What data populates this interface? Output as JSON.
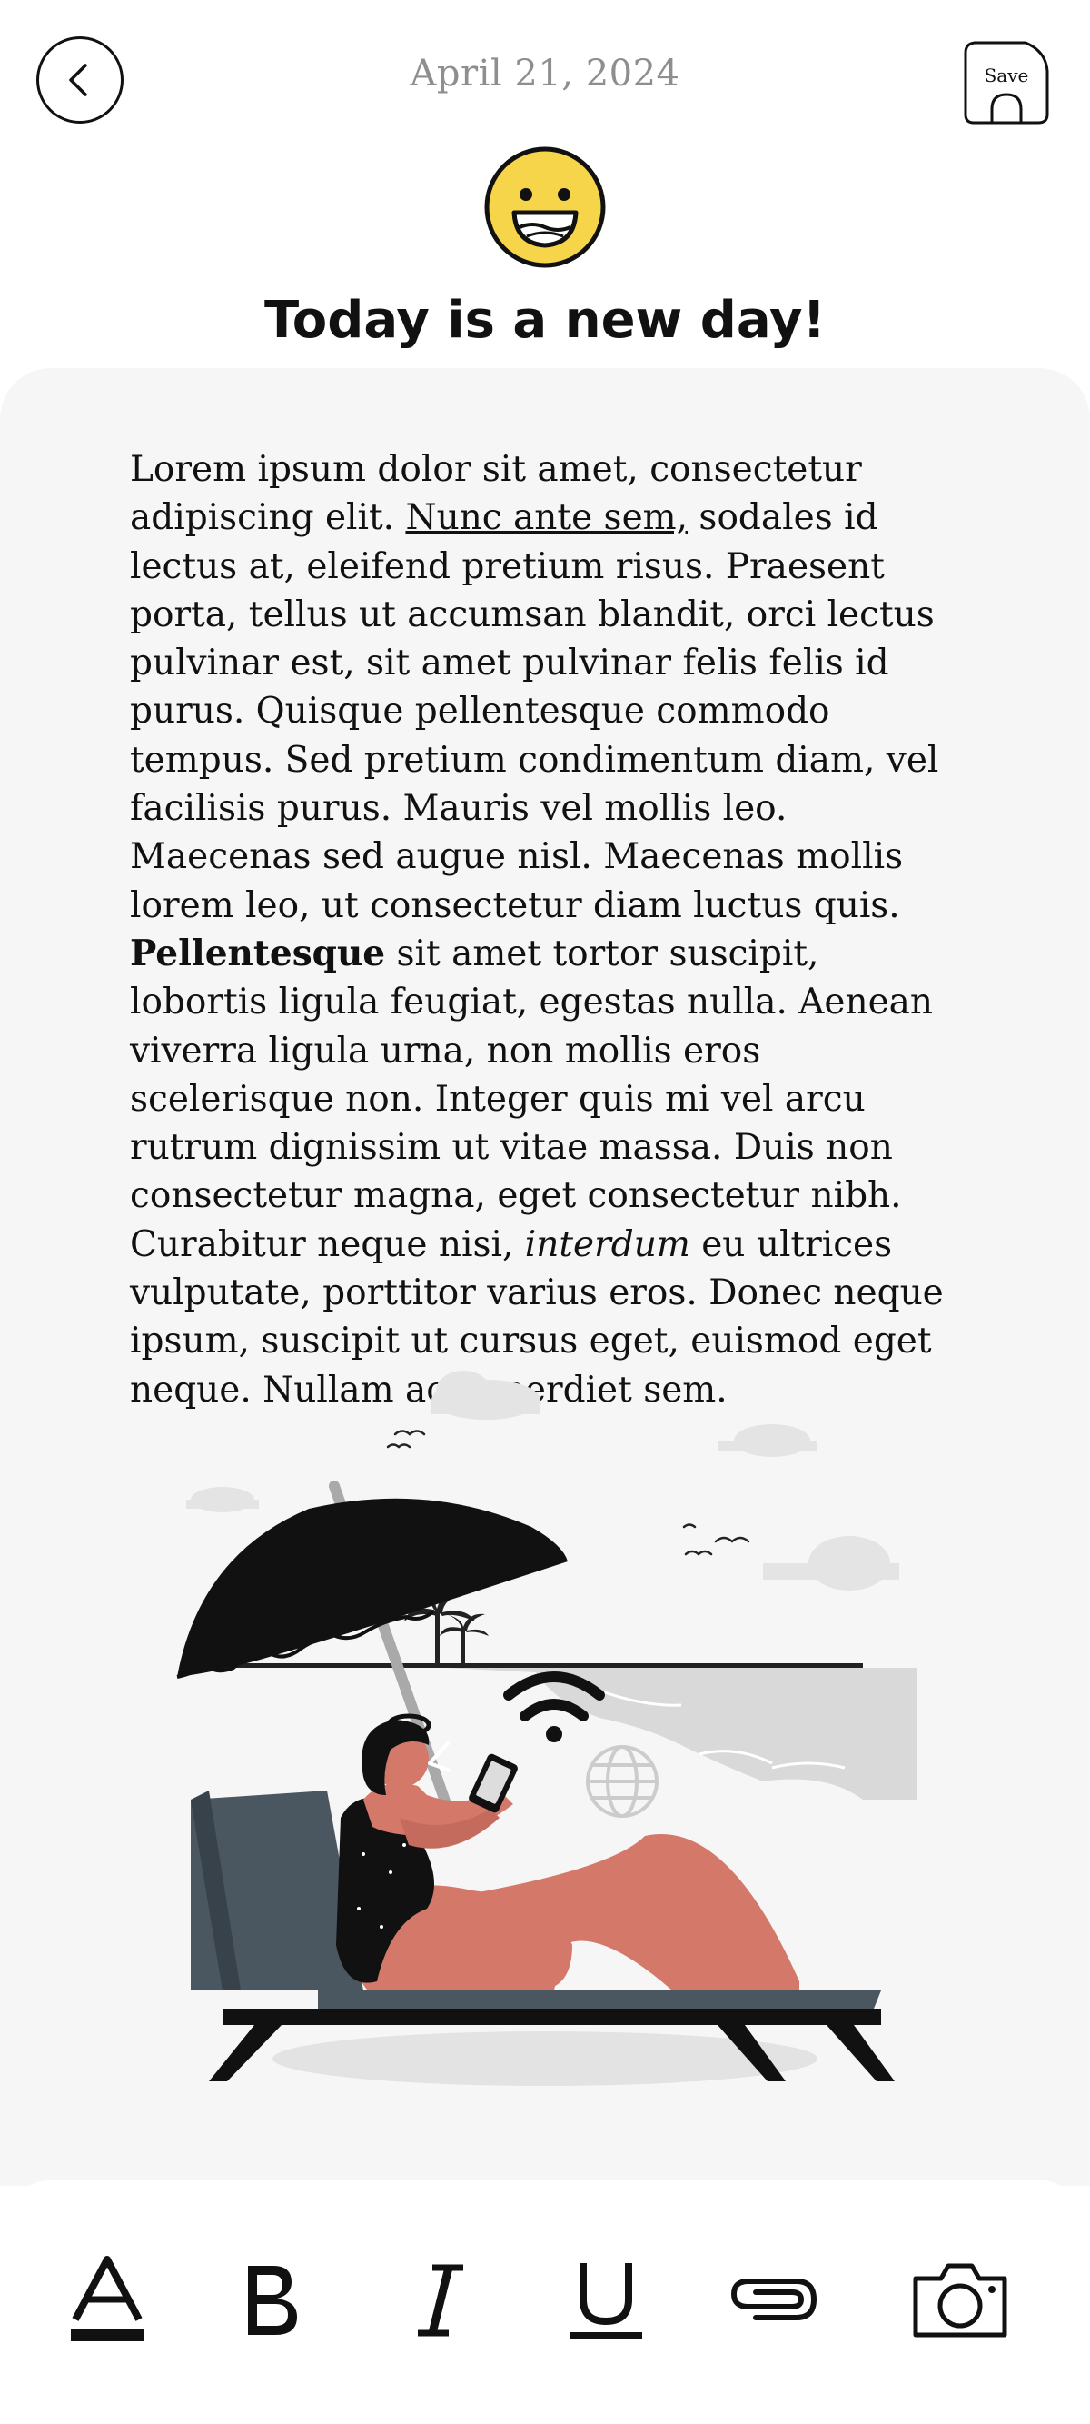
{
  "header": {
    "date": "April 21, 2024",
    "save_label": "Save"
  },
  "entry": {
    "mood_icon": "grinning-face-icon",
    "title": "Today is a new day!",
    "body": {
      "p1": "Lorem ipsum dolor sit amet, consectetur adipiscing elit. ",
      "underlined": "Nunc ante sem,",
      "p2": " sodales id lectus at, eleifend pretium risus. Praesent porta, tellus ut accumsan blandit, orci lectus pulvinar est, sit amet pulvinar felis felis id purus. Quisque pellentesque commodo tempus. Sed pretium condimentum diam, vel facilisis purus. Mauris vel mollis leo. Maecenas sed augue nisl. Maecenas mollis lorem leo, ut consectetur diam luctus quis. ",
      "bold": "Pellentesque",
      "p3": " sit amet tortor suscipit, lobortis ligula feugiat, egestas nulla. Aenean viverra ligula urna, non mollis eros scelerisque non. Integer quis mi vel arcu rutrum dignissim ut vitae massa. Duis non consectetur magna, eget consectetur nibh. Curabitur neque nisi, ",
      "italic": "interdum",
      "p4": " eu ultrices vulputate, porttitor varius eros. Donec neque ipsum, suscipit ut cursus eget, euismod eget neque. Nullam ac imperdiet sem."
    },
    "illustration": "woman-on-beach-lounger-with-phone"
  },
  "toolbar": {
    "tools": [
      "text-color-icon",
      "bold-icon",
      "italic-icon",
      "underline-icon",
      "attachment-icon",
      "camera-icon"
    ]
  },
  "colors": {
    "background": "#ffffff",
    "card": "#f6f6f6",
    "date": "#8e8e8e",
    "emoji_yellow": "#f7d54a",
    "skin": "#d4786a",
    "lounger": "#4a5660"
  }
}
